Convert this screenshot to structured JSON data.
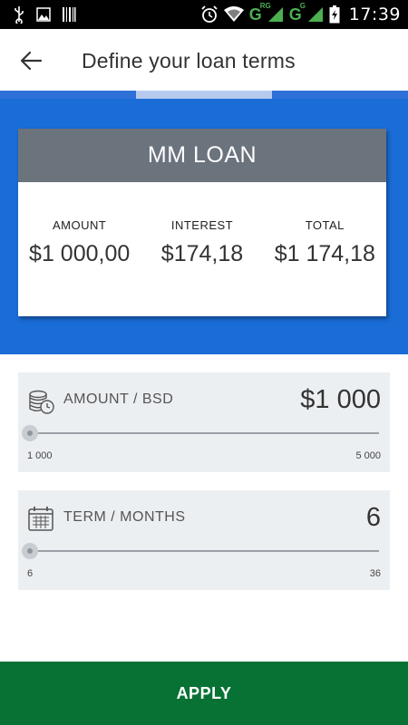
{
  "status_bar": {
    "time": "17:39",
    "network_label": "G",
    "network_sub": "RG",
    "network_label_2": "G",
    "network_sub_2": "G",
    "icons": [
      "usb-icon",
      "image-icon",
      "barcode-icon",
      "alarm-icon",
      "wifi-icon",
      "signal-icon",
      "battery-icon"
    ]
  },
  "header": {
    "title": "Define your loan terms"
  },
  "progress": {
    "step": 2,
    "total_steps": 3
  },
  "summary": {
    "title": "MM LOAN",
    "columns": [
      {
        "label": "AMOUNT",
        "value": "$1 000,00"
      },
      {
        "label": "INTEREST",
        "value": "$174,18"
      },
      {
        "label": "TOTAL",
        "value": "$1 174,18"
      }
    ]
  },
  "amount_slider": {
    "label": "AMOUNT / BSD",
    "value": "$1 000",
    "min_label": "1 000",
    "max_label": "5 000",
    "fraction": 0.0,
    "icon": "coins-clock-icon"
  },
  "term_slider": {
    "label": "TERM / MONTHS",
    "value": "6",
    "min_label": "6",
    "max_label": "36",
    "fraction": 0.0,
    "icon": "calendar-icon"
  },
  "apply_button": {
    "label": "APPLY"
  },
  "colors": {
    "primary_blue": "#1a6cd6",
    "card_header": "#6b737d",
    "apply_green": "#087235",
    "panel_bg": "#eceff2"
  }
}
